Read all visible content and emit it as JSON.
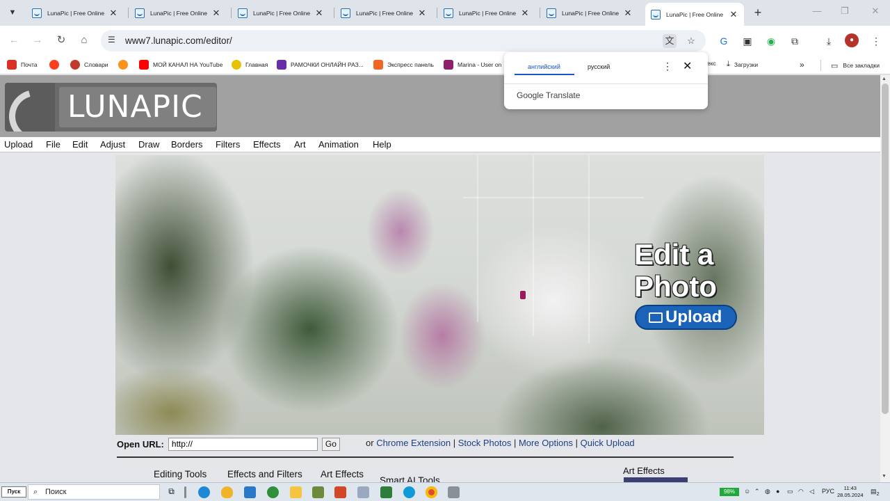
{
  "browser": {
    "tabs": [
      {
        "title": "LunaPic | Free Online"
      },
      {
        "title": "LunaPic | Free Online"
      },
      {
        "title": "LunaPic | Free Online"
      },
      {
        "title": "LunaPic | Free Online"
      },
      {
        "title": "LunaPic | Free Online"
      },
      {
        "title": "LunaPic | Free Online"
      },
      {
        "title": "LunaPic | Free Online"
      }
    ],
    "url": "www7.lunapic.com/editor/"
  },
  "bookmarks": [
    {
      "label": "Почта",
      "icon": "gmail-icon",
      "color": "#d93025"
    },
    {
      "label": "",
      "icon": "yandex-icon",
      "color": "#fc3f1d"
    },
    {
      "label": "Словари",
      "icon": "dictionary-icon",
      "color": "#c0392b"
    },
    {
      "label": "",
      "icon": "ok-icon",
      "color": "#f7931e"
    },
    {
      "label": "МОЙ КАНАЛ НА YouTube",
      "icon": "youtube-icon",
      "color": "#ff0000"
    },
    {
      "label": "Главная",
      "icon": "home-site-icon",
      "color": "#e6c200"
    },
    {
      "label": "РАМОЧКИ ОНЛАЙН РАЗ...",
      "icon": "jpg-icon",
      "color": "#6a2da8"
    },
    {
      "label": "Экспресс панель",
      "icon": "express-icon",
      "color": "#f26522"
    },
    {
      "label": "Marina - User on",
      "icon": "marina-icon",
      "color": "#8e1f6b"
    },
    {
      "label": "екс",
      "icon": "partial-icon",
      "color": "#ffffff"
    },
    {
      "label": "Загрузки",
      "icon": "download-icon",
      "color": "#444444"
    },
    {
      "label": "Все закладки",
      "icon": "folder-icon",
      "color": "#444444"
    }
  ],
  "translate_popup": {
    "lang_from": "английский",
    "lang_to": "русский",
    "brand": "Google Translate"
  },
  "site": {
    "logo_text": "LUNAPIC",
    "menu": [
      "Upload",
      "File",
      "Edit",
      "Adjust",
      "Draw",
      "Borders",
      "Filters",
      "Effects",
      "Art",
      "Animation",
      "Help"
    ],
    "hero_title_1": "Edit a",
    "hero_title_2": "Photo",
    "hero_button": "Upload",
    "open_url_label": "Open URL:",
    "open_url_value": "http://",
    "go_label": "Go",
    "or_text": "or",
    "links": [
      "Chrome Extension",
      "Stock Photos",
      "More Options",
      "Quick Upload"
    ],
    "subtabs": [
      "Editing Tools",
      "Effects and Filters",
      "Art Effects",
      "Smart AI Tools"
    ],
    "side_heading": "Art Effects"
  },
  "taskbar": {
    "start_label": "Пуск",
    "search_placeholder": "Поиск",
    "battery": "98%",
    "lang": "РУС",
    "time": "11:43",
    "date": "28.05.2024",
    "notifications": "2"
  }
}
